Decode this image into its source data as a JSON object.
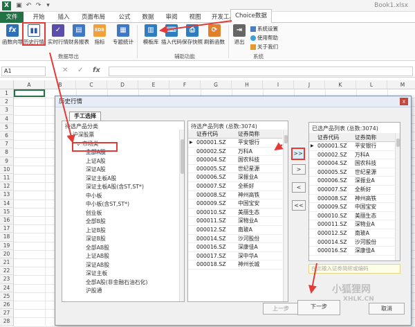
{
  "window": {
    "doc_title": "Book1.xlsx"
  },
  "tabs": [
    "文件",
    "开始",
    "插入",
    "页面布局",
    "公式",
    "数据",
    "审阅",
    "视图",
    "开发工具",
    "Choice数据"
  ],
  "ribbon": {
    "buttons": [
      {
        "label": "函数向导",
        "icon": "fx",
        "color": "#2e6fb5"
      },
      {
        "label": "历史行情",
        "icon": "bar-chart-icon",
        "color": "#2d5aa0"
      },
      {
        "label": "实时行情",
        "icon": "check-chart-icon",
        "color": "#5b4da8"
      },
      {
        "label": "财务报表",
        "icon": "report-icon",
        "color": "#3f77c4"
      },
      {
        "label": "指标",
        "icon": "EDB",
        "color": "#f2a03a"
      },
      {
        "label": "专题统计",
        "icon": "stats-icon",
        "color": "#3f77c4"
      },
      {
        "label": "模板库",
        "icon": "template-icon",
        "color": "#2e7dc0"
      },
      {
        "label": "插入代码",
        "icon": "code-icon",
        "color": "#2e7dc0"
      },
      {
        "label": "保存快照",
        "icon": "snapshot-icon",
        "color": "#2e7dc0"
      },
      {
        "label": "刷新函数",
        "icon": "refresh-icon",
        "color": "#e27f2c"
      },
      {
        "label": "退出",
        "icon": "exit-icon",
        "color": "#555"
      }
    ],
    "groups": [
      "数据导出",
      "辅助功能",
      "系统"
    ],
    "system_items": [
      "系统设置",
      "使用帮助",
      "关于我们"
    ]
  },
  "formula_bar": {
    "name_box": "A1",
    "fx": "fx"
  },
  "grid": {
    "columns": [
      "A",
      "B",
      "C",
      "D",
      "E",
      "F",
      "G",
      "H",
      "I",
      "J",
      "K",
      "L",
      "M"
    ],
    "rows": [
      "1",
      "2",
      "3",
      "4",
      "5",
      "6",
      "7",
      "8",
      "9",
      "10",
      "11",
      "12",
      "13",
      "14",
      "15",
      "16",
      "17",
      "18",
      "19",
      "20",
      "21",
      "22",
      "23",
      "24",
      "25",
      "26",
      "27",
      "28"
    ]
  },
  "dialog": {
    "title": "历史行情",
    "close": "x",
    "tab": "手工选择",
    "left_panel": {
      "title": "待选产品分类",
      "items": [
        {
          "label": "沪深股票",
          "level": 0
        },
        {
          "label": "市场类",
          "level": 1
        },
        {
          "label": "全部A股",
          "level": 2,
          "selected": true
        },
        {
          "label": "上证A股",
          "level": 2
        },
        {
          "label": "深证A股",
          "level": 2
        },
        {
          "label": "深证主板A股",
          "level": 2
        },
        {
          "label": "深证主板A股(含ST,ST*)",
          "level": 2
        },
        {
          "label": "中小板",
          "level": 2
        },
        {
          "label": "中小板(含ST,ST*)",
          "level": 2
        },
        {
          "label": "创业板",
          "level": 2
        },
        {
          "label": "全部B股",
          "level": 2
        },
        {
          "label": "上证B股",
          "level": 2
        },
        {
          "label": "深证B股",
          "level": 2
        },
        {
          "label": "全部AB股",
          "level": 2
        },
        {
          "label": "上证AB股",
          "level": 2
        },
        {
          "label": "深证AB股",
          "level": 2
        },
        {
          "label": "深证主板",
          "level": 2
        },
        {
          "label": "全部A股(非金融石油石化)",
          "level": 2
        },
        {
          "label": "沪股通",
          "level": 2
        }
      ]
    },
    "mid_panel": {
      "title": "待选产品列表 (总数:3074)",
      "col_code": "证券代码",
      "col_name": "证券简称",
      "rows": [
        [
          "000001.SZ",
          "平安银行"
        ],
        [
          "000002.SZ",
          "万科A"
        ],
        [
          "000004.SZ",
          "国农科技"
        ],
        [
          "000005.SZ",
          "世纪星源"
        ],
        [
          "000006.SZ",
          "深振业A"
        ],
        [
          "000007.SZ",
          "全新好"
        ],
        [
          "000008.SZ",
          "神州高铁"
        ],
        [
          "000009.SZ",
          "中国宝安"
        ],
        [
          "000010.SZ",
          "美丽生态"
        ],
        [
          "000011.SZ",
          "深物业A"
        ],
        [
          "000012.SZ",
          "南玻A"
        ],
        [
          "000014.SZ",
          "沙河股份"
        ],
        [
          "000016.SZ",
          "深康佳A"
        ],
        [
          "000017.SZ",
          "深中华A"
        ],
        [
          "000018.SZ",
          "神州长城"
        ]
      ]
    },
    "move_buttons": [
      ">>",
      ">",
      "<",
      "<<"
    ],
    "right_panel": {
      "title": "已选产品列表 (总数:3074)",
      "col_code": "证券代码",
      "col_name": "证券简称",
      "rows": [
        [
          "000001.SZ",
          "平安银行"
        ],
        [
          "000002.SZ",
          "万科A"
        ],
        [
          "000004.SZ",
          "国农科技"
        ],
        [
          "000005.SZ",
          "世纪星源"
        ],
        [
          "000006.SZ",
          "深振业A"
        ],
        [
          "000007.SZ",
          "全新好"
        ],
        [
          "000008.SZ",
          "神州高铁"
        ],
        [
          "000009.SZ",
          "中国宝安"
        ],
        [
          "000010.SZ",
          "美丽生态"
        ],
        [
          "000011.SZ",
          "深物业A"
        ],
        [
          "000012.SZ",
          "南玻A"
        ],
        [
          "000014.SZ",
          "沙河股份"
        ],
        [
          "000016.SZ",
          "深康佳A"
        ]
      ],
      "search_placeholder": "在此输入证券简称或编码"
    },
    "buttons": {
      "prev": "上一步",
      "next": "下一步",
      "cancel": "取消"
    }
  },
  "watermark": {
    "cn": "小狐狸网",
    "en": "XHLK.CN"
  },
  "colors": {
    "excel_green": "#217346",
    "highlight_red": "#e53935"
  }
}
